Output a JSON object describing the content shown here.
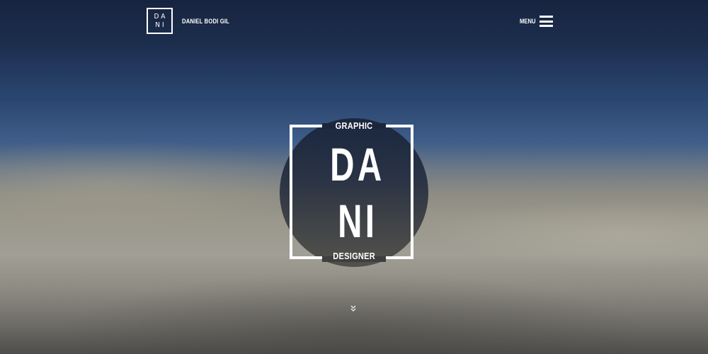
{
  "header": {
    "logo_line1": "DA",
    "logo_line2": "NI",
    "brand_name": "DANIEL BODI GIL",
    "menu_label": "MENU",
    "menu_icon": "hamburger-icon"
  },
  "hero": {
    "top_word": "GRAPHIC",
    "big_line1": "DA",
    "big_line2": "NI",
    "bottom_word": "DESIGNER"
  },
  "scroll": {
    "icon": "double-chevron-down-icon",
    "glyph": "⌄\n⌄"
  },
  "colors": {
    "text": "#ffffff",
    "sky_top": "#17243f",
    "sky_mid": "#3e5d88",
    "ground": "#9a978b"
  }
}
